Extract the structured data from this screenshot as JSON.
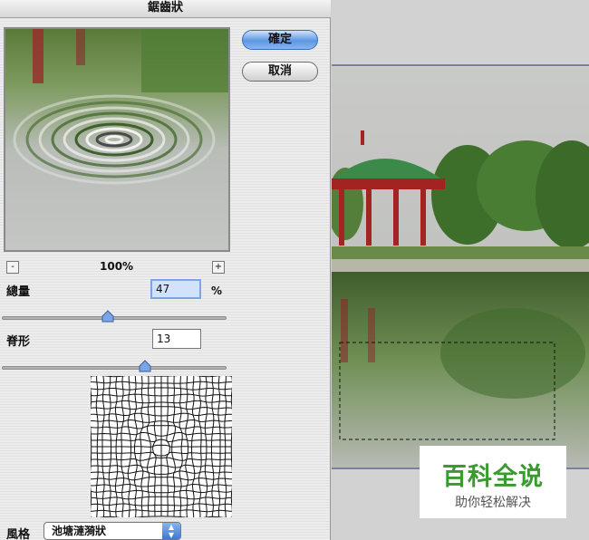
{
  "dialog": {
    "title": "鋸齒狀",
    "ok_label": "確定",
    "cancel_label": "取消",
    "zoom_out": "-",
    "zoom_in": "+",
    "zoom_level": "100%",
    "amount_label": "總量",
    "amount_value": "47",
    "amount_unit": "%",
    "amount_fraction": 0.47,
    "ridges_label": "脊形",
    "ridges_value": "13",
    "style_label": "風格",
    "style_value": "池塘漣漪狀"
  },
  "watermark": {
    "title": "百科全说",
    "subtitle": "助你轻松解决"
  },
  "colors": {
    "accent": "#5c97e2",
    "watermark_green": "#3a9a2e"
  },
  "icons": [
    "slider-thumb-icon",
    "select-arrows-icon"
  ]
}
